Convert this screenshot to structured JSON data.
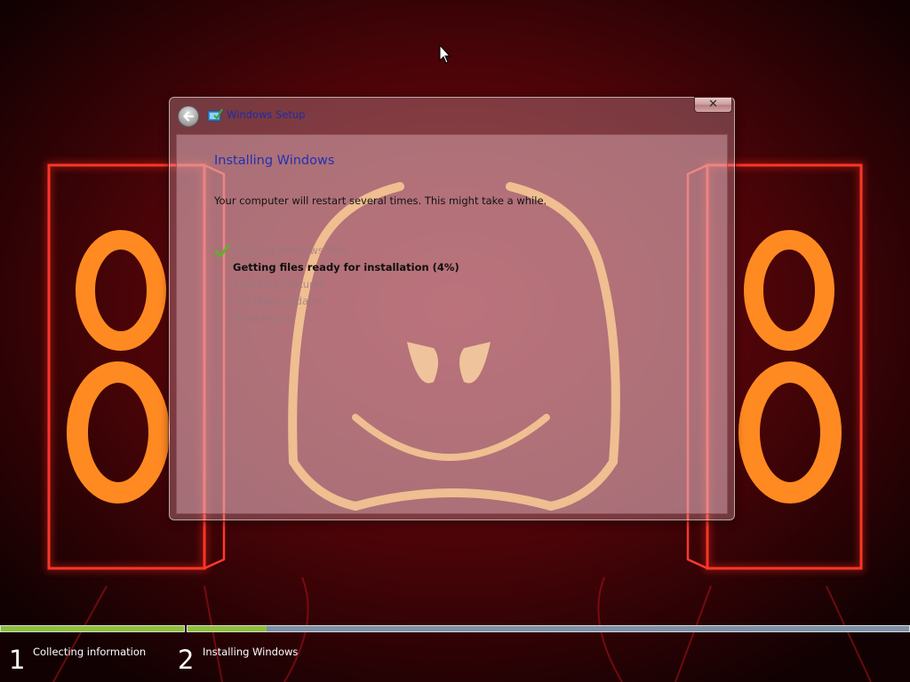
{
  "window": {
    "title": "Windows Setup",
    "close_label": "✕"
  },
  "content": {
    "heading": "Installing Windows",
    "subtitle": "Your computer will restart several times. This might take a while.",
    "steps": [
      {
        "label": "Copying Windows files",
        "status": "done"
      },
      {
        "label": "Getting files ready for installation (4%)",
        "status": "current"
      },
      {
        "label": "Installing features",
        "status": "pending"
      },
      {
        "label": "Installing updates",
        "status": "pending"
      },
      {
        "label": "Finishing up",
        "status": "pending"
      }
    ]
  },
  "progress": {
    "stages": [
      {
        "number": "1",
        "label": "Collecting information",
        "fill": 1.0
      },
      {
        "number": "2",
        "label": "Installing Windows",
        "fill": 0.11
      }
    ]
  },
  "icons": {
    "back": "back-arrow-icon",
    "setup": "windows-setup-icon",
    "check": "checkmark-icon",
    "close": "close-icon",
    "cursor": "mouse-pointer-icon"
  },
  "colors": {
    "accent_title": "#2231b3",
    "progress_green": "#8ebf3a",
    "progress_remaining": "#7e8fa6",
    "check_green": "#5fb12b"
  }
}
